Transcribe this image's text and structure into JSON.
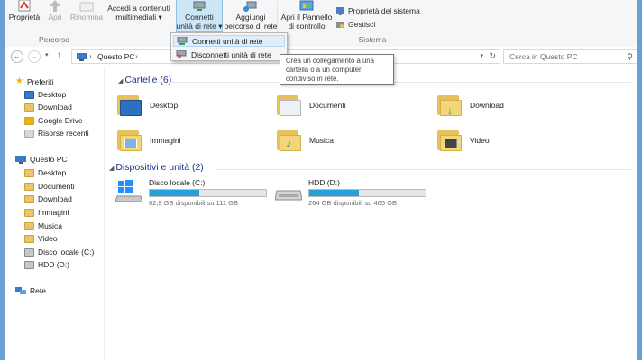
{
  "ribbon": {
    "buttons": [
      {
        "label": "Proprietà"
      },
      {
        "label": "Apri"
      },
      {
        "label": "Rinomina"
      },
      {
        "label_line1": "Accedi a contenuti",
        "label_line2": "multimediali ▾"
      },
      {
        "label_line1": "Connetti",
        "label_line2": "unità di rete ▾"
      },
      {
        "label_line1": "Aggiungi",
        "label_line2": "percorso di rete"
      },
      {
        "label_line1": "Apri il Pannello",
        "label_line2": "di controllo"
      }
    ],
    "small_items": [
      "Proprietà del sistema",
      "Gestisci"
    ],
    "groups": [
      "Percorso",
      "Sistema"
    ]
  },
  "dropdown": {
    "items": [
      "Connetti unità di rete",
      "Disconnetti unità di rete"
    ]
  },
  "tooltip": {
    "line1": "Crea un collegamento a una",
    "line2": "cartella o a un computer",
    "line3": "condiviso in rete."
  },
  "address": {
    "path": "Questo PC",
    "search_placeholder": "Cerca in Questo PC"
  },
  "sidebar": {
    "favorites_header": "Preferiti",
    "favorites": [
      "Desktop",
      "Download",
      "Google Drive",
      "Risorse recenti"
    ],
    "pc_header": "Questo PC",
    "pc_items": [
      "Desktop",
      "Documenti",
      "Download",
      "Immagini",
      "Musica",
      "Video",
      "Disco locale (C:)",
      "HDD (D:)"
    ],
    "network": "Rete"
  },
  "main": {
    "folders_title": "Cartelle (6)",
    "folders": [
      "Desktop",
      "Documenti",
      "Download",
      "Immagini",
      "Musica",
      "Video"
    ],
    "drives_title": "Dispositivi e unità (2)",
    "drives": [
      {
        "name": "Disco locale (C:)",
        "free": "62,9 GB disponibili su 111 GB",
        "used_fraction": 0.43
      },
      {
        "name": "HDD (D:)",
        "free": "264 GB disponibili su 465 GB",
        "used_fraction": 0.43
      }
    ]
  },
  "colors": {
    "accent": "#26a0da",
    "section_title": "#1e3287",
    "folder": "#f4d67a"
  }
}
